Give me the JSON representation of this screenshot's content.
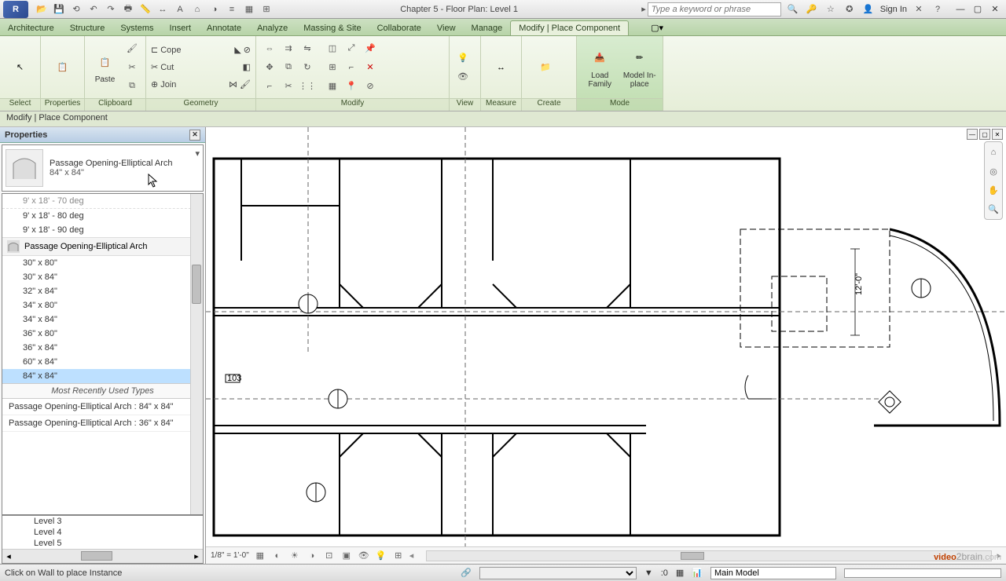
{
  "titlebar": {
    "title": "Chapter 5 - Floor Plan: Level 1",
    "search_placeholder": "Type a keyword or phrase",
    "signin": "Sign In"
  },
  "ribbon_tabs": [
    "Architecture",
    "Structure",
    "Systems",
    "Insert",
    "Annotate",
    "Analyze",
    "Massing & Site",
    "Collaborate",
    "View",
    "Manage",
    "Modify | Place Component"
  ],
  "active_tab_index": 10,
  "ribbon": {
    "select": "Select",
    "properties": "Properties",
    "paste": "Paste",
    "clipboard": "Clipboard",
    "cope": "Cope",
    "cut": "Cut",
    "join": "Join",
    "geometry": "Geometry",
    "modify": "Modify",
    "view": "View",
    "measure": "Measure",
    "create": "Create",
    "load_family": "Load Family",
    "model_inplace": "Model In-place",
    "mode": "Mode"
  },
  "context_label": "Modify | Place Component",
  "properties": {
    "header": "Properties",
    "type_name": "Passage Opening-Elliptical Arch",
    "type_size": "84\" x 84\"",
    "partial_item": "9' x 18' - 70 deg",
    "list_items": [
      "9' x 18' - 80 deg",
      "9' x 18' - 90 deg"
    ],
    "category": "Passage Opening-Elliptical Arch",
    "sizes": [
      "30\" x 80\"",
      "30\" x 84\"",
      "32\" x 84\"",
      "34\" x 80\"",
      "34\" x 84\"",
      "36\" x 80\"",
      "36\" x 84\"",
      "60\" x 84\"",
      "84\" x 84\""
    ],
    "selected_size_index": 8,
    "mru_header": "Most Recently Used Types",
    "mru": [
      "Passage Opening-Elliptical Arch : 84\" x 84\"",
      "Passage Opening-Elliptical Arch : 36\" x 84\""
    ],
    "tree": [
      "Level 3",
      "Level 4",
      "Level 5"
    ]
  },
  "vcb": {
    "scale": "1/8\" = 1'-0\""
  },
  "status": {
    "msg": "Click on Wall to place Instance",
    "filter_count": ":0",
    "workset": "Main Model"
  },
  "watermark": "video2brain.com",
  "dim_label": "12'-0\""
}
